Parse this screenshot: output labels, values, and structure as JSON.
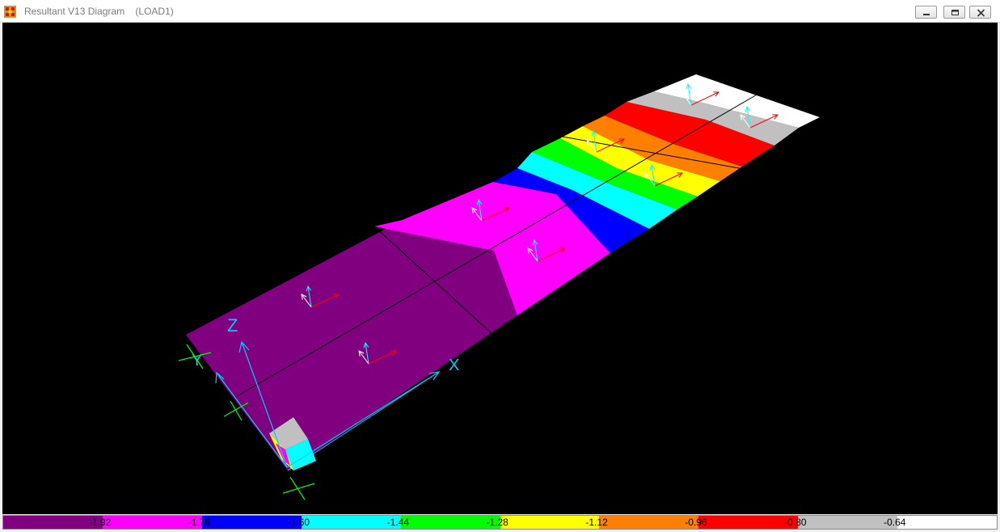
{
  "window": {
    "title": "Resultant V13 Diagram    (LOAD1)",
    "icon": "app-logo-icon",
    "controls": [
      "minimize-icon",
      "restore-icon",
      "close-icon"
    ]
  },
  "view": {
    "background": "#000000",
    "axis_labels": {
      "z": "Z",
      "y": "Y",
      "x": "X"
    },
    "axis_colors": {
      "local_x": "#ff0000",
      "local_y": "#ffffff",
      "local_z": "#00ffff",
      "global": "#00ff00",
      "support": "#00ccff"
    }
  },
  "legend": {
    "values": [
      "-1.92",
      "-1.76",
      "-1.60",
      "-1.44",
      "-1.28",
      "-1.12",
      "-0.96",
      "-0.80",
      "-0.64"
    ],
    "colors": [
      "#800080",
      "#ff00ff",
      "#0000ff",
      "#00ffff",
      "#00ff00",
      "#ffff00",
      "#ff8000",
      "#ff0000",
      "#c0c0c0",
      "#ffffff"
    ]
  }
}
